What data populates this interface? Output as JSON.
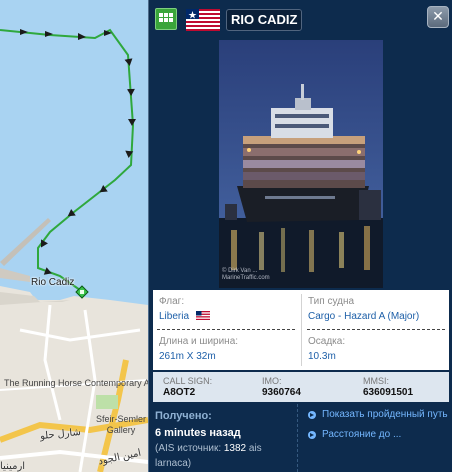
{
  "map": {
    "ship_label": "Rio Cadiz",
    "poi_label": "The Running Horse Contemporary Art Space",
    "gallery_label": "Sfeir-Semler Gallery",
    "arabic_labels": [
      "شارل حلو",
      "امين الجود",
      "ارمينيا"
    ]
  },
  "vessel": {
    "name": "RIO CADIZ",
    "photo_credit": "© Dirk Van ...\nMarineTraffic.com",
    "flag_label": "Флаг:",
    "flag_value": "Liberia",
    "type_label": "Тип судна",
    "type_value": "Cargo - Hazard A (Major)",
    "size_label": "Длина и ширина:",
    "size_value": "261m X 32m",
    "draught_label": "Осадка:",
    "draught_value": "10.3m",
    "callsign_label": "CALL SIGN:",
    "callsign_value": "A8OT2",
    "imo_label": "IMO:",
    "imo_value": "9360764",
    "mmsi_label": "MMSI:",
    "mmsi_value": "636091501"
  },
  "received": {
    "label": "Получено:",
    "time": "6 minutes назад",
    "source_prefix": "(AIS источник: ",
    "source_id": "1382",
    "source_suffix": " ais larnaca)"
  },
  "links": [
    {
      "label": "Показать пройденный путь"
    },
    {
      "label": "Расстояние до ..."
    }
  ],
  "colors": {
    "panel_bg": "#0d2b4d",
    "link": "#74b7ff",
    "track": "#2fa83d",
    "sea": "#a9d3f2"
  },
  "icons": {
    "grid_button": "grid-icon",
    "close_button": "close-icon",
    "link_arrow": "arrow-right-circle-icon",
    "flag": "liberia-flag-icon",
    "ship_marker": "ship-marker-icon"
  }
}
